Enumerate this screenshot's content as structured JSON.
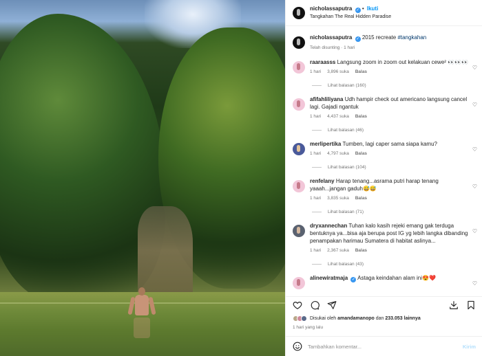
{
  "post": {
    "username": "nicholassaputra",
    "follow_label": "Ikuti",
    "location": "Tangkahan The Real Hidden Paradise",
    "separator": "•"
  },
  "caption": {
    "username": "nicholassaputra",
    "text": "2015 recreate",
    "hashtag": "#tangkahan",
    "meta": "Telah disunting · 1 hari"
  },
  "comments": [
    {
      "username": "raaraasss",
      "text": "Langsung zoom in zoom out kelakuan cewe² 👀👀👀",
      "time": "1 hari",
      "likes": "3,896 suka",
      "reply": "Balas",
      "view_replies": "Lihat balasan (160)"
    },
    {
      "username": "afifahliliyana",
      "text": "Udh hampir check out americano langsung cancel lagi. Gajadi ngantuk",
      "time": "1 hari",
      "likes": "4,437 suka",
      "reply": "Balas",
      "view_replies": "Lihat balasan (46)"
    },
    {
      "username": "merlipertika",
      "text": "Tumben, lagi caper sama siapa kamu?",
      "time": "1 hari",
      "likes": "4,797 suka",
      "reply": "Balas",
      "view_replies": "Lihat balasan (104)"
    },
    {
      "username": "renfelany",
      "text": "Harap tenang...asrama putri harap tenang yaaah...jangan gaduh😅😅",
      "time": "1 hari",
      "likes": "3,835 suka",
      "reply": "Balas",
      "view_replies": "Lihat balasan (71)"
    },
    {
      "username": "dryxannechan",
      "text": "Tuhan kalo kasih rejeki emang gak terduga bentuknya ya...bisa aja berupa post IG yg lebih langka dibanding penampakan harimau Sumatera di habitat aslinya...",
      "time": "1 hari",
      "likes": "2,367 suka",
      "reply": "Balas",
      "view_replies": "Lihat balasan (43)"
    },
    {
      "username": "alinewiratmaja",
      "text": "Astaga keindahan alam ini😍❤️"
    }
  ],
  "likes_bar": {
    "prefix": "Disukai oleh",
    "user": "amandamanopo",
    "connector": "dan",
    "count": "233.053 lainnya"
  },
  "timestamp": "1 hari yang lalu",
  "composer": {
    "placeholder": "Tambahkan komentar...",
    "post_label": "Kirim"
  },
  "icons": [
    "emoji-icon",
    "heart-icon",
    "comment-icon",
    "share-icon",
    "save-icon",
    "repost-icon"
  ]
}
